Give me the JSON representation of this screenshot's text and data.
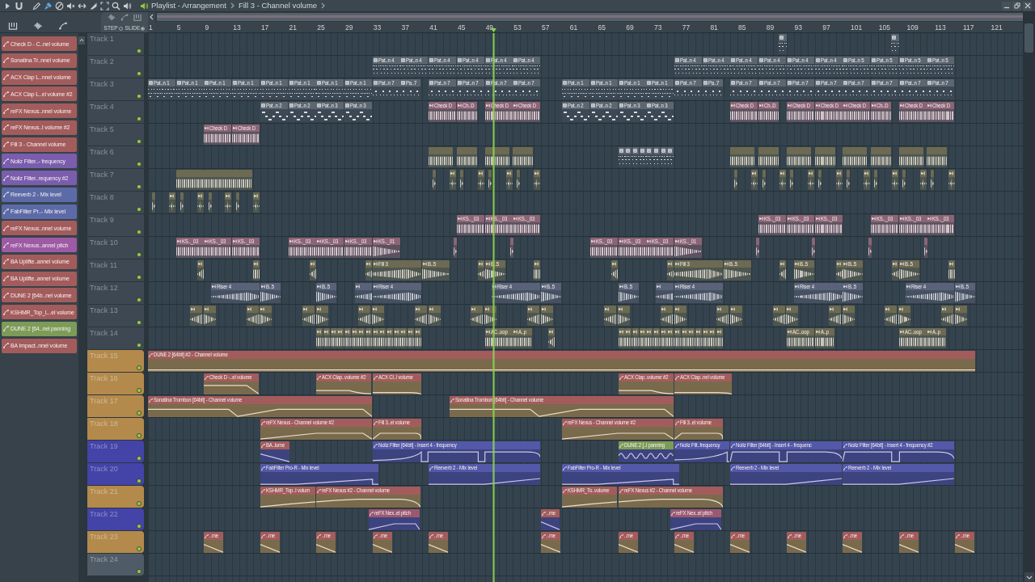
{
  "title_bar": {
    "crumbs": [
      "Playlist - Arrangement",
      "Fill 3 - Channel volume"
    ]
  },
  "snap_modes": [
    {
      "label": "STEP",
      "selected": false
    },
    {
      "label": "SLIDE",
      "selected": true
    }
  ],
  "ruler": {
    "marks": [
      "1",
      "5",
      "9",
      "13",
      "17",
      "21",
      "25",
      "29",
      "33",
      "37",
      "41",
      "45",
      "49",
      "53",
      "57",
      "61",
      "65",
      "69",
      "73",
      "77",
      "81",
      "85",
      "89",
      "93",
      "97",
      "101",
      "105",
      "109",
      "113",
      "117",
      "121"
    ]
  },
  "playhead": {
    "level": 0.395
  },
  "picker": {
    "items": [
      {
        "label": "Check D - C..nel volume",
        "color": "#a35c5c"
      },
      {
        "label": "Sonatina Tr..nnel volume",
        "color": "#a35c5c"
      },
      {
        "label": "ACX Clap L..nnel volume",
        "color": "#a35c5c"
      },
      {
        "label": "ACX Clap L..el volume #2",
        "color": "#a35c5c"
      },
      {
        "label": "reFX Nexus..nnel volume",
        "color": "#a35c5c"
      },
      {
        "label": "reFX Nexus..l volume #2",
        "color": "#a35c5c"
      },
      {
        "label": "Fill 3 - Channel volume",
        "color": "#a35c5c"
      },
      {
        "label": "Noiiz Filter..- frequency",
        "color": "#7a5dad"
      },
      {
        "label": "Noiiz Filter..requency #2",
        "color": "#7a5dad"
      },
      {
        "label": "Reeverb 2 - Mix level",
        "color": "#5c6ba8"
      },
      {
        "label": "FabFilter Pr..- Mix level",
        "color": "#5c6ba8"
      },
      {
        "label": "reFX Nexus..nnel volume",
        "color": "#a35c5c"
      },
      {
        "label": "reFX Nexus..annel pitch",
        "color": "#9d5aa5"
      },
      {
        "label": "BA Uplifte..annel volume",
        "color": "#a35c5c"
      },
      {
        "label": "BA Uplifte..annel volume",
        "color": "#a35c5c"
      },
      {
        "label": "DUNE 2 [64b..nel volume",
        "color": "#a35c5c"
      },
      {
        "label": "KSHMR_Top_L..el volume",
        "color": "#a35c5c"
      },
      {
        "label": "DUNE 2 [64..nel panning",
        "color": "#7d9c58"
      },
      {
        "label": "BA Impact..nnel volume",
        "color": "#a35c5c"
      }
    ]
  },
  "tracks": [
    {
      "name": "Track 1",
      "color": "#3d4852",
      "enabled": true,
      "clips": [
        {
          "kind": "pattern",
          "color": "#5c6670"
        },
        {
          "kind": "pattern",
          "color": "#5c6670"
        }
      ]
    },
    {
      "name": "Track 2",
      "color": "#3d4852",
      "enabled": true,
      "clips": [
        {
          "kind": "pattern",
          "label": "Pat..n 4",
          "color": "#5c6670"
        },
        {
          "kind": "pattern",
          "label": "Pat..n 4",
          "color": "#5c6670"
        },
        {
          "kind": "pattern",
          "label": "Pat..n 4",
          "color": "#5c6670"
        },
        {
          "kind": "pattern",
          "label": "Pat..n 4",
          "color": "#5c6670"
        },
        {
          "kind": "pattern",
          "label": "Pat..n 4",
          "color": "#5c6670"
        },
        {
          "kind": "pattern",
          "label": "Pat..n 4",
          "color": "#5c6670"
        },
        {
          "kind": "pattern",
          "label": "Pat..n 4",
          "color": "#5c6670"
        },
        {
          "kind": "pattern",
          "label": "Pat..n 4",
          "color": "#5c6670"
        },
        {
          "kind": "pattern",
          "label": "Pat..n 4",
          "color": "#5c6670"
        },
        {
          "kind": "pattern",
          "label": "Pat..n 4",
          "color": "#5c6670"
        },
        {
          "kind": "pattern",
          "label": "Pat..n 4",
          "color": "#5c6670"
        },
        {
          "kind": "pattern",
          "label": "Pat..n 4",
          "color": "#5c6670"
        },
        {
          "kind": "pattern",
          "label": "Pat..n 5",
          "color": "#5c6670"
        },
        {
          "kind": "pattern",
          "label": "Pat..n 5",
          "color": "#5c6670"
        },
        {
          "kind": "pattern",
          "label": "Pat..n 5",
          "color": "#5c6670"
        },
        {
          "kind": "pattern",
          "label": "Pat..n 5",
          "color": "#5c6670"
        }
      ]
    },
    {
      "name": "Track 3",
      "color": "#3d4852",
      "enabled": true,
      "clips": [
        {
          "kind": "pattern",
          "label": "Pat..n 1",
          "color": "#5c6670"
        },
        {
          "kind": "pattern",
          "label": "Pat..n 1",
          "color": "#5c6670"
        },
        {
          "kind": "pattern",
          "label": "Pat..n 1",
          "color": "#5c6670"
        },
        {
          "kind": "pattern",
          "label": "Pat..n 1",
          "color": "#5c6670"
        },
        {
          "kind": "pattern",
          "label": "Pat..n 1",
          "color": "#5c6670"
        },
        {
          "kind": "pattern",
          "label": "Pat..n 1",
          "color": "#5c6670"
        },
        {
          "kind": "pattern",
          "label": "Pat..n 1",
          "color": "#5c6670"
        },
        {
          "kind": "pattern",
          "label": "Pat..n 1",
          "color": "#5c6670"
        },
        {
          "kind": "pattern",
          "label": "Pat..n 7",
          "color": "#5c6670"
        },
        {
          "kind": "pattern",
          "label": "Pa..7",
          "color": "#5c6670"
        },
        {
          "kind": "pattern",
          "label": "Pat..n 7",
          "color": "#5c6670"
        },
        {
          "kind": "pattern",
          "label": "Pat..n 7",
          "color": "#5c6670"
        },
        {
          "kind": "pattern",
          "label": "Pat..n 7",
          "color": "#5c6670"
        },
        {
          "kind": "pattern",
          "label": "Pat..n 7",
          "color": "#5c6670"
        },
        {
          "kind": "pattern",
          "label": "Pat..n 1",
          "color": "#5c6670"
        },
        {
          "kind": "pattern",
          "label": "Pat..n 1",
          "color": "#5c6670"
        },
        {
          "kind": "pattern",
          "label": "Pat..n 1",
          "color": "#5c6670"
        },
        {
          "kind": "pattern",
          "label": "Pat..n 1",
          "color": "#5c6670"
        },
        {
          "kind": "pattern",
          "label": "Pat..n 7",
          "color": "#5c6670"
        },
        {
          "kind": "pattern",
          "label": "Pa..7",
          "color": "#5c6670"
        },
        {
          "kind": "pattern",
          "label": "Pat..n 7",
          "color": "#5c6670"
        },
        {
          "kind": "pattern",
          "label": "Pat..n 7",
          "color": "#5c6670"
        },
        {
          "kind": "pattern",
          "label": "Pat..n 7",
          "color": "#5c6670"
        },
        {
          "kind": "pattern",
          "label": "Pat..n 7",
          "color": "#5c6670"
        },
        {
          "kind": "pattern",
          "label": "Pat..n 7",
          "color": "#5c6670"
        },
        {
          "kind": "pattern",
          "label": "Pat..n 7",
          "color": "#5c6670"
        },
        {
          "kind": "pattern",
          "label": "Pat..n 7",
          "color": "#5c6670"
        },
        {
          "kind": "pattern",
          "label": "Pat..n 7",
          "color": "#5c6670"
        }
      ]
    },
    {
      "name": "Track 4",
      "color": "#3d4852",
      "enabled": true,
      "clips": [
        {
          "kind": "pattern",
          "label": "Pat..n 2",
          "color": "#5c6670"
        },
        {
          "kind": "pattern",
          "label": "Pat..n 2",
          "color": "#5c6670"
        },
        {
          "kind": "pattern",
          "label": "Pat..n 3",
          "color": "#5c6670"
        },
        {
          "kind": "pattern",
          "label": "Pat..n 3",
          "color": "#5c6670"
        },
        {
          "kind": "audio",
          "label": "Check D",
          "color": "#8c6475"
        },
        {
          "kind": "audio",
          "label": "Ch..D",
          "color": "#8c6475"
        },
        {
          "kind": "audio",
          "label": "Check D",
          "color": "#8c6475"
        },
        {
          "kind": "audio",
          "label": "Check D",
          "color": "#8c6475"
        },
        {
          "kind": "pattern",
          "label": "Pat..n 2",
          "color": "#5c6670"
        },
        {
          "kind": "pattern",
          "label": "Pat..n 2",
          "color": "#5c6670"
        },
        {
          "kind": "pattern",
          "label": "Pat..n 3",
          "color": "#5c6670"
        },
        {
          "kind": "pattern",
          "label": "Pat..n 3",
          "color": "#5c6670"
        },
        {
          "kind": "audio",
          "label": "Check D",
          "color": "#8c6475"
        },
        {
          "kind": "audio",
          "label": "Ch..D",
          "color": "#8c6475"
        },
        {
          "kind": "audio",
          "label": "Check D",
          "color": "#8c6475"
        },
        {
          "kind": "audio",
          "label": "Check D",
          "color": "#8c6475"
        },
        {
          "kind": "audio",
          "label": "Check D",
          "color": "#8c6475"
        },
        {
          "kind": "audio",
          "label": "Ch..D",
          "color": "#8c6475"
        },
        {
          "kind": "audio",
          "label": "Check D",
          "color": "#8c6475"
        },
        {
          "kind": "audio",
          "label": "Check D",
          "color": "#8c6475"
        }
      ]
    },
    {
      "name": "Track 5",
      "color": "#3d4852",
      "enabled": true,
      "clips": [
        {
          "kind": "audio",
          "label": "Check D",
          "color": "#8c6475"
        },
        {
          "kind": "audio",
          "label": "Check D",
          "color": "#8c6475"
        }
      ]
    },
    {
      "name": "Track 6",
      "color": "#3d4852",
      "enabled": true,
      "clips": [
        {
          "kind": "audio",
          "color": "#6c6a52"
        },
        {
          "kind": "audio",
          "color": "#6c6a52"
        },
        {
          "kind": "audio",
          "color": "#6c6a52"
        },
        {
          "kind": "audio",
          "color": "#6c6a52"
        },
        {
          "kind": "pattern",
          "color": "#5c6670"
        },
        {
          "kind": "pattern",
          "color": "#5c6670"
        },
        {
          "kind": "pattern",
          "color": "#5c6670"
        },
        {
          "kind": "pattern",
          "color": "#5c6670"
        },
        {
          "kind": "pattern",
          "color": "#5c6670"
        },
        {
          "kind": "pattern",
          "color": "#5c6670"
        },
        {
          "kind": "pattern",
          "color": "#5c6670"
        },
        {
          "kind": "pattern",
          "color": "#5c6670"
        },
        {
          "kind": "audio",
          "color": "#6c6a52"
        },
        {
          "kind": "audio",
          "color": "#6c6a52"
        },
        {
          "kind": "audio",
          "color": "#6c6a52"
        },
        {
          "kind": "audio",
          "color": "#6c6a52"
        },
        {
          "kind": "audio",
          "color": "#6c6a52"
        },
        {
          "kind": "audio",
          "color": "#6c6a52"
        },
        {
          "kind": "audio",
          "color": "#6c6a52"
        },
        {
          "kind": "audio",
          "color": "#6c6a52"
        }
      ]
    },
    {
      "name": "Track 7",
      "color": "#3d4852",
      "enabled": true,
      "clips": [
        {
          "kind": "audio",
          "color": "#6c6a52"
        },
        {
          "kind": "audio",
          "color": "#6c6a52"
        },
        {
          "kind": "audio",
          "color": "#6c6a52"
        },
        {
          "kind": "audio",
          "color": "#6c6a52"
        },
        {
          "kind": "audio",
          "color": "#6c6a52"
        },
        {
          "kind": "audio",
          "color": "#6c6a52"
        },
        {
          "kind": "audio",
          "color": "#6c6a52"
        },
        {
          "kind": "audio",
          "color": "#6c6a52"
        },
        {
          "kind": "audio",
          "color": "#6c6a52"
        },
        {
          "kind": "audio",
          "color": "#6c6a52"
        },
        {
          "kind": "audio",
          "color": "#6c6a52"
        },
        {
          "kind": "audio",
          "color": "#6c6a52"
        },
        {
          "kind": "audio",
          "color": "#6c6a52"
        },
        {
          "kind": "audio",
          "color": "#6c6a52"
        },
        {
          "kind": "audio",
          "color": "#6c6a52"
        },
        {
          "kind": "audio",
          "color": "#6c6a52"
        },
        {
          "kind": "audio",
          "color": "#6c6a52"
        },
        {
          "kind": "audio",
          "color": "#6c6a52"
        },
        {
          "kind": "audio",
          "color": "#6c6a52"
        },
        {
          "kind": "audio",
          "color": "#6c6a52"
        },
        {
          "kind": "audio",
          "color": "#6c6a52"
        },
        {
          "kind": "audio",
          "color": "#6c6a52"
        },
        {
          "kind": "audio",
          "color": "#6c6a52"
        },
        {
          "kind": "audio",
          "color": "#6c6a52"
        },
        {
          "kind": "audio",
          "color": "#6c6a52"
        },
        {
          "kind": "audio",
          "color": "#6c6a52"
        }
      ]
    },
    {
      "name": "Track 8",
      "color": "#3d4852",
      "enabled": true,
      "clips": [
        {
          "kind": "audio",
          "color": "#6c6a52"
        },
        {
          "kind": "audio",
          "color": "#6c6a52"
        },
        {
          "kind": "audio",
          "color": "#6c6a52"
        },
        {
          "kind": "audio",
          "color": "#6c6a52"
        },
        {
          "kind": "audio",
          "color": "#6c6a52"
        },
        {
          "kind": "audio",
          "color": "#6c6a52"
        },
        {
          "kind": "audio",
          "color": "#6c6a52"
        },
        {
          "kind": "audio",
          "color": "#6c6a52"
        }
      ]
    },
    {
      "name": "Track 9",
      "color": "#3d4852",
      "enabled": true,
      "clips": [
        {
          "kind": "audio",
          "label": "KS.._03",
          "color": "#8c6475"
        },
        {
          "kind": "audio",
          "label": "KS.._03",
          "color": "#8c6475"
        },
        {
          "kind": "audio",
          "label": "KS.._03",
          "color": "#8c6475"
        },
        {
          "kind": "audio",
          "label": "KS.._03",
          "color": "#8c6475"
        },
        {
          "kind": "audio",
          "label": "KS.._03",
          "color": "#8c6475"
        },
        {
          "kind": "audio",
          "label": "KS.._03",
          "color": "#8c6475"
        },
        {
          "kind": "audio",
          "label": "KS.._03",
          "color": "#8c6475"
        },
        {
          "kind": "audio",
          "label": "KS.._03",
          "color": "#8c6475"
        },
        {
          "kind": "audio",
          "label": "KS.._03",
          "color": "#8c6475"
        }
      ]
    },
    {
      "name": "Track 10",
      "color": "#3d4852",
      "enabled": true,
      "clips": [
        {
          "kind": "audio",
          "label": "KS.._03",
          "color": "#8c6475"
        },
        {
          "kind": "audio",
          "label": "KS.._03",
          "color": "#8c6475"
        },
        {
          "kind": "audio",
          "label": "KS.._03",
          "color": "#8c6475"
        },
        {
          "kind": "audio",
          "label": "KS.._03",
          "color": "#8c6475"
        },
        {
          "kind": "audio",
          "label": "KS.._03",
          "color": "#8c6475"
        },
        {
          "kind": "audio",
          "label": "KS.._03",
          "color": "#8c6475"
        },
        {
          "kind": "audio",
          "label": "KS.._01",
          "color": "#8c6475"
        },
        {
          "kind": "audio",
          "color": "#8c6475"
        },
        {
          "kind": "audio",
          "color": "#8c6475"
        },
        {
          "kind": "audio",
          "label": "KS.._03",
          "color": "#8c6475"
        },
        {
          "kind": "audio",
          "label": "KS.._03",
          "color": "#8c6475"
        },
        {
          "kind": "audio",
          "label": "KS.._03",
          "color": "#8c6475"
        },
        {
          "kind": "audio",
          "label": "KS.._01",
          "color": "#8c6475"
        },
        {
          "kind": "audio",
          "color": "#8c6475"
        },
        {
          "kind": "audio",
          "color": "#8c6475"
        },
        {
          "kind": "audio",
          "color": "#8c6475"
        },
        {
          "kind": "audio",
          "color": "#8c6475"
        }
      ]
    },
    {
      "name": "Track 11",
      "color": "#3d4852",
      "enabled": true,
      "clips": [
        {
          "kind": "audio",
          "color": "#6c6a52"
        },
        {
          "kind": "audio",
          "color": "#6c6a52"
        },
        {
          "kind": "audio",
          "color": "#6c6a52"
        },
        {
          "kind": "audio",
          "color": "#6c6a52"
        },
        {
          "kind": "audio",
          "label": "Fill 3",
          "color": "#6c6a52"
        },
        {
          "kind": "audio",
          "label": "B..5",
          "color": "#6c6a52"
        },
        {
          "kind": "audio",
          "color": "#6c6a52"
        },
        {
          "kind": "audio",
          "label": "B..5",
          "color": "#6c6a52"
        },
        {
          "kind": "audio",
          "color": "#6c6a52"
        },
        {
          "kind": "audio",
          "color": "#6c6a52"
        },
        {
          "kind": "audio",
          "color": "#6c6a52"
        },
        {
          "kind": "audio",
          "label": "Fill 3",
          "color": "#6c6a52"
        },
        {
          "kind": "audio",
          "label": "B..5",
          "color": "#6c6a52"
        },
        {
          "kind": "audio",
          "color": "#6c6a52"
        },
        {
          "kind": "audio",
          "label": "B..5",
          "color": "#6c6a52"
        },
        {
          "kind": "audio",
          "color": "#6c6a52"
        },
        {
          "kind": "audio",
          "label": "B..5",
          "color": "#6c6a52"
        },
        {
          "kind": "audio",
          "color": "#6c6a52"
        },
        {
          "kind": "audio",
          "label": "B..5",
          "color": "#6c6a52"
        },
        {
          "kind": "audio",
          "color": "#6c6a52"
        }
      ]
    },
    {
      "name": "Track 12",
      "color": "#3d4852",
      "enabled": true,
      "clips": [
        {
          "kind": "audio",
          "label": "Riser 4",
          "color": "#5a6279"
        },
        {
          "kind": "audio",
          "label": "B..5",
          "color": "#5a6279"
        },
        {
          "kind": "audio",
          "label": "B..5",
          "color": "#5a6279"
        },
        {
          "kind": "audio",
          "color": "#5a6279"
        },
        {
          "kind": "audio",
          "label": "Riser 4",
          "color": "#5a6279"
        },
        {
          "kind": "audio",
          "label": "Riser 4",
          "color": "#5a6279"
        },
        {
          "kind": "audio",
          "label": "B..5",
          "color": "#5a6279"
        },
        {
          "kind": "audio",
          "label": "B..5",
          "color": "#5a6279"
        },
        {
          "kind": "audio",
          "color": "#5a6279"
        },
        {
          "kind": "audio",
          "label": "Riser 4",
          "color": "#5a6279"
        },
        {
          "kind": "audio",
          "label": "Riser 4",
          "color": "#5a6279"
        },
        {
          "kind": "audio",
          "label": "B..5",
          "color": "#5a6279"
        },
        {
          "kind": "audio",
          "label": "Riser 4",
          "color": "#5a6279"
        },
        {
          "kind": "audio",
          "label": "B..5",
          "color": "#5a6279"
        }
      ]
    },
    {
      "name": "Track 13",
      "color": "#3d4852",
      "enabled": true,
      "clips": [
        {
          "kind": "audio",
          "color": "#6c6a52"
        },
        {
          "kind": "audio",
          "color": "#6c6a52"
        },
        {
          "kind": "audio",
          "color": "#6c6a52"
        },
        {
          "kind": "audio",
          "color": "#6c6a52"
        },
        {
          "kind": "audio",
          "color": "#6c6a52"
        },
        {
          "kind": "audio",
          "color": "#6c6a52"
        },
        {
          "kind": "audio",
          "color": "#6c6a52"
        },
        {
          "kind": "audio",
          "color": "#6c6a52"
        },
        {
          "kind": "audio",
          "color": "#6c6a52"
        },
        {
          "kind": "audio",
          "color": "#6c6a52"
        },
        {
          "kind": "audio",
          "color": "#6c6a52"
        },
        {
          "kind": "audio",
          "color": "#6c6a52"
        },
        {
          "kind": "audio",
          "color": "#6c6a52"
        },
        {
          "kind": "audio",
          "color": "#6c6a52"
        },
        {
          "kind": "audio",
          "color": "#6c6a52"
        },
        {
          "kind": "audio",
          "color": "#6c6a52"
        },
        {
          "kind": "audio",
          "color": "#6c6a52"
        },
        {
          "kind": "audio",
          "color": "#6c6a52"
        },
        {
          "kind": "audio",
          "color": "#6c6a52"
        },
        {
          "kind": "audio",
          "color": "#6c6a52"
        },
        {
          "kind": "audio",
          "color": "#6c6a52"
        },
        {
          "kind": "audio",
          "color": "#6c6a52"
        },
        {
          "kind": "audio",
          "color": "#6c6a52"
        },
        {
          "kind": "audio",
          "color": "#6c6a52"
        },
        {
          "kind": "audio",
          "color": "#6c6a52"
        },
        {
          "kind": "audio",
          "color": "#6c6a52"
        },
        {
          "kind": "audio",
          "color": "#6c6a52"
        },
        {
          "kind": "audio",
          "color": "#6c6a52"
        }
      ]
    },
    {
      "name": "Track 14",
      "color": "#3d4852",
      "enabled": true,
      "clips": [
        {
          "kind": "audio",
          "color": "#6c6a52"
        },
        {
          "kind": "audio",
          "color": "#6c6a52"
        },
        {
          "kind": "audio",
          "color": "#6c6a52"
        },
        {
          "kind": "audio",
          "color": "#6c6a52"
        },
        {
          "kind": "audio",
          "color": "#6c6a52"
        },
        {
          "kind": "audio",
          "color": "#6c6a52"
        },
        {
          "kind": "audio",
          "color": "#6c6a52"
        },
        {
          "kind": "audio",
          "color": "#6c6a52"
        },
        {
          "kind": "audio",
          "color": "#6c6a52"
        },
        {
          "kind": "audio",
          "color": "#6c6a52"
        },
        {
          "kind": "audio",
          "color": "#6c6a52"
        },
        {
          "kind": "audio",
          "color": "#6c6a52"
        },
        {
          "kind": "audio",
          "color": "#6c6a52"
        },
        {
          "kind": "audio",
          "color": "#6c6a52"
        },
        {
          "kind": "audio",
          "color": "#6c6a52"
        },
        {
          "kind": "audio",
          "label": "AC..oop",
          "color": "#6c6a52"
        },
        {
          "kind": "audio",
          "label": "A..p",
          "color": "#6c6a52"
        },
        {
          "kind": "audio",
          "color": "#6c6a52"
        },
        {
          "kind": "audio",
          "color": "#6c6a52"
        },
        {
          "kind": "audio",
          "color": "#6c6a52"
        },
        {
          "kind": "audio",
          "color": "#6c6a52"
        },
        {
          "kind": "audio",
          "color": "#6c6a52"
        },
        {
          "kind": "audio",
          "color": "#6c6a52"
        },
        {
          "kind": "audio",
          "color": "#6c6a52"
        },
        {
          "kind": "audio",
          "color": "#6c6a52"
        },
        {
          "kind": "audio",
          "color": "#6c6a52"
        },
        {
          "kind": "audio",
          "color": "#6c6a52"
        },
        {
          "kind": "audio",
          "color": "#6c6a52"
        },
        {
          "kind": "audio",
          "color": "#6c6a52"
        },
        {
          "kind": "audio",
          "color": "#6c6a52"
        },
        {
          "kind": "audio",
          "color": "#6c6a52"
        },
        {
          "kind": "audio",
          "color": "#6c6a52"
        },
        {
          "kind": "audio",
          "color": "#6c6a52"
        },
        {
          "kind": "audio",
          "label": "AC..oop",
          "color": "#6c6a52"
        },
        {
          "kind": "audio",
          "label": "A..p",
          "color": "#6c6a52"
        },
        {
          "kind": "audio",
          "label": "AC..oop",
          "color": "#6c6a52"
        },
        {
          "kind": "audio",
          "label": "A..p",
          "color": "#6c6a52"
        }
      ]
    },
    {
      "name": "Track 15",
      "color": "#b38a4c",
      "enabled": true,
      "clips": [
        {
          "kind": "automation",
          "label": "DUNE 2 [64bit] #2 - Channel volume",
          "color": "#a35c5c"
        }
      ]
    },
    {
      "name": "Track 16",
      "color": "#b38a4c",
      "enabled": true,
      "clips": [
        {
          "kind": "automation",
          "label": "Check D -..el volume",
          "color": "#a35c5c"
        },
        {
          "kind": "automation",
          "label": "ACX Clap..volume #2",
          "color": "#a35c5c"
        },
        {
          "kind": "automation",
          "label": "ACX Cl..l volume",
          "color": "#a35c5c"
        },
        {
          "kind": "automation",
          "label": "ACX Clap..volume #2",
          "color": "#a35c5c"
        },
        {
          "kind": "automation",
          "label": "ACX Clap..nel volume",
          "color": "#a35c5c"
        }
      ]
    },
    {
      "name": "Track 17",
      "color": "#b38a4c",
      "enabled": true,
      "clips": [
        {
          "kind": "automation",
          "label": "Sonatina Trombon [64bit] - Channel volume",
          "color": "#a35c5c"
        },
        {
          "kind": "automation",
          "label": "Sonatina Trombon [64bit] - Channel volume",
          "color": "#a35c5c"
        }
      ]
    },
    {
      "name": "Track 18",
      "color": "#b38a4c",
      "enabled": true,
      "clips": [
        {
          "kind": "automation",
          "label": "reFX Nexus - Channel volume #2",
          "color": "#a35c5c"
        },
        {
          "kind": "automation",
          "label": "Fill 3..el volume",
          "color": "#a35c5c"
        },
        {
          "kind": "automation",
          "label": "reFX Nexus - Channel volume #2",
          "color": "#a35c5c"
        },
        {
          "kind": "automation",
          "label": "Fill 3..el volume",
          "color": "#a35c5c"
        }
      ]
    },
    {
      "name": "Track 19",
      "color": "#4443a8",
      "enabled": true,
      "clips": [
        {
          "kind": "automation",
          "label": "BA..lume",
          "color": "#a35c5c"
        },
        {
          "kind": "automation",
          "label": "Noiiz Filter [64bit] - Insert 4 - frequency",
          "color": "#5458a8"
        },
        {
          "kind": "automation",
          "label": "DUNE 2 [..l panning",
          "color": "#7d9c58"
        },
        {
          "kind": "automation",
          "label": "Noiiz Filt..frequency",
          "color": "#5458a8"
        },
        {
          "kind": "automation",
          "label": "Noiiz Filter [64bit] - Insert 4 - frequenc",
          "color": "#5458a8"
        },
        {
          "kind": "automation",
          "label": "Noiiz Filter [64bit] - Insert 4 - frequency #2",
          "color": "#5458a8"
        }
      ]
    },
    {
      "name": "Track 20",
      "color": "#4443a8",
      "enabled": true,
      "clips": [
        {
          "kind": "automation",
          "label": "FabFilter Pro-R - Mix level",
          "color": "#5458a8"
        },
        {
          "kind": "automation",
          "label": "Reeverb 2 - Mix level",
          "color": "#5458a8"
        },
        {
          "kind": "automation",
          "label": "FabFilter Pro-R - Mix level",
          "color": "#5458a8"
        },
        {
          "kind": "automation",
          "label": "Reeverb 2 - Mix level",
          "color": "#5458a8"
        },
        {
          "kind": "automation",
          "label": "Reeverb 2 - Mix level",
          "color": "#5458a8"
        }
      ]
    },
    {
      "name": "Track 21",
      "color": "#b38a4c",
      "enabled": true,
      "clips": [
        {
          "kind": "automation",
          "label": "KSHMR_Top..l volum",
          "color": "#a35c5c"
        },
        {
          "kind": "automation",
          "label": "reFX Nexus #2 - Channel volume",
          "color": "#a35c5c"
        },
        {
          "kind": "automation",
          "label": "KSHMR_To..volume",
          "color": "#a35c5c"
        },
        {
          "kind": "automation",
          "label": "reFX Nexus #2 - Channel volume",
          "color": "#a35c5c"
        }
      ]
    },
    {
      "name": "Track 22",
      "color": "#4443a8",
      "enabled": true,
      "clips": [
        {
          "kind": "automation",
          "label": "reFX Nex..el pitch",
          "color": "#9c5870"
        },
        {
          "kind": "automation",
          "label": "..me",
          "color": "#a35c5c"
        },
        {
          "kind": "automation",
          "label": "reFX Nex..el pitch",
          "color": "#9c5870"
        }
      ]
    },
    {
      "name": "Track 23",
      "color": "#b38a4c",
      "enabled": true,
      "clips": [
        {
          "kind": "automation",
          "label": "..me",
          "color": "#a35c5c"
        },
        {
          "kind": "automation",
          "label": "..me",
          "color": "#a35c5c"
        },
        {
          "kind": "automation",
          "label": "..me",
          "color": "#a35c5c"
        },
        {
          "kind": "automation",
          "label": "..me",
          "color": "#a35c5c"
        },
        {
          "kind": "automation",
          "label": "..me",
          "color": "#a35c5c"
        },
        {
          "kind": "automation",
          "label": "..me",
          "color": "#a35c5c"
        },
        {
          "kind": "automation",
          "label": "..me",
          "color": "#a35c5c"
        },
        {
          "kind": "automation",
          "label": "..me",
          "color": "#a35c5c"
        },
        {
          "kind": "automation",
          "label": "..me",
          "color": "#a35c5c"
        },
        {
          "kind": "automation",
          "label": "..me",
          "color": "#a35c5c"
        },
        {
          "kind": "automation",
          "label": "..me",
          "color": "#a35c5c"
        },
        {
          "kind": "automation",
          "label": "..me",
          "color": "#a35c5c"
        },
        {
          "kind": "automation",
          "label": "..me",
          "color": "#a35c5c"
        }
      ]
    },
    {
      "name": "Track 24",
      "color": "#4f5b66",
      "enabled": true
    }
  ]
}
